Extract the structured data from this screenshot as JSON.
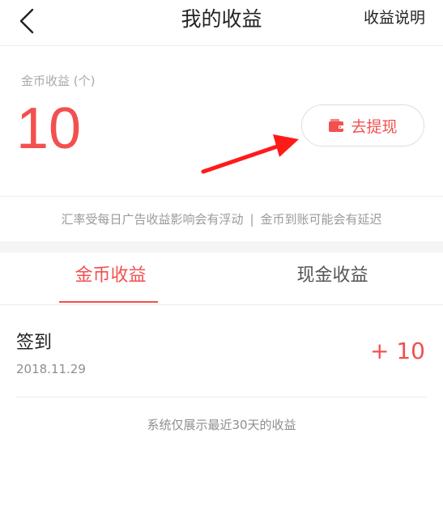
{
  "header": {
    "title": "我的收益",
    "right_link": "收益说明",
    "back_icon": "chevron-left-icon"
  },
  "summary": {
    "coin_label": "金币收益 (个)",
    "coin_amount": "10",
    "withdraw_label": "去提现",
    "withdraw_icon": "wallet-icon"
  },
  "notice": {
    "left": "汇率受每日广告收益影响会有浮动",
    "separator": "|",
    "right": "金币到账可能会有延迟"
  },
  "tabs": [
    {
      "label": "金币收益",
      "active": true
    },
    {
      "label": "现金收益",
      "active": false
    }
  ],
  "records": [
    {
      "title": "签到",
      "date": "2018.11.29",
      "amount": "+ 10"
    }
  ],
  "footer_note": "系统仅展示最近30天的收益",
  "colors": {
    "accent": "#f2504f",
    "annotation_arrow": "#ff1a1a",
    "muted_text": "#9a9a9a",
    "divider": "#ececec"
  }
}
